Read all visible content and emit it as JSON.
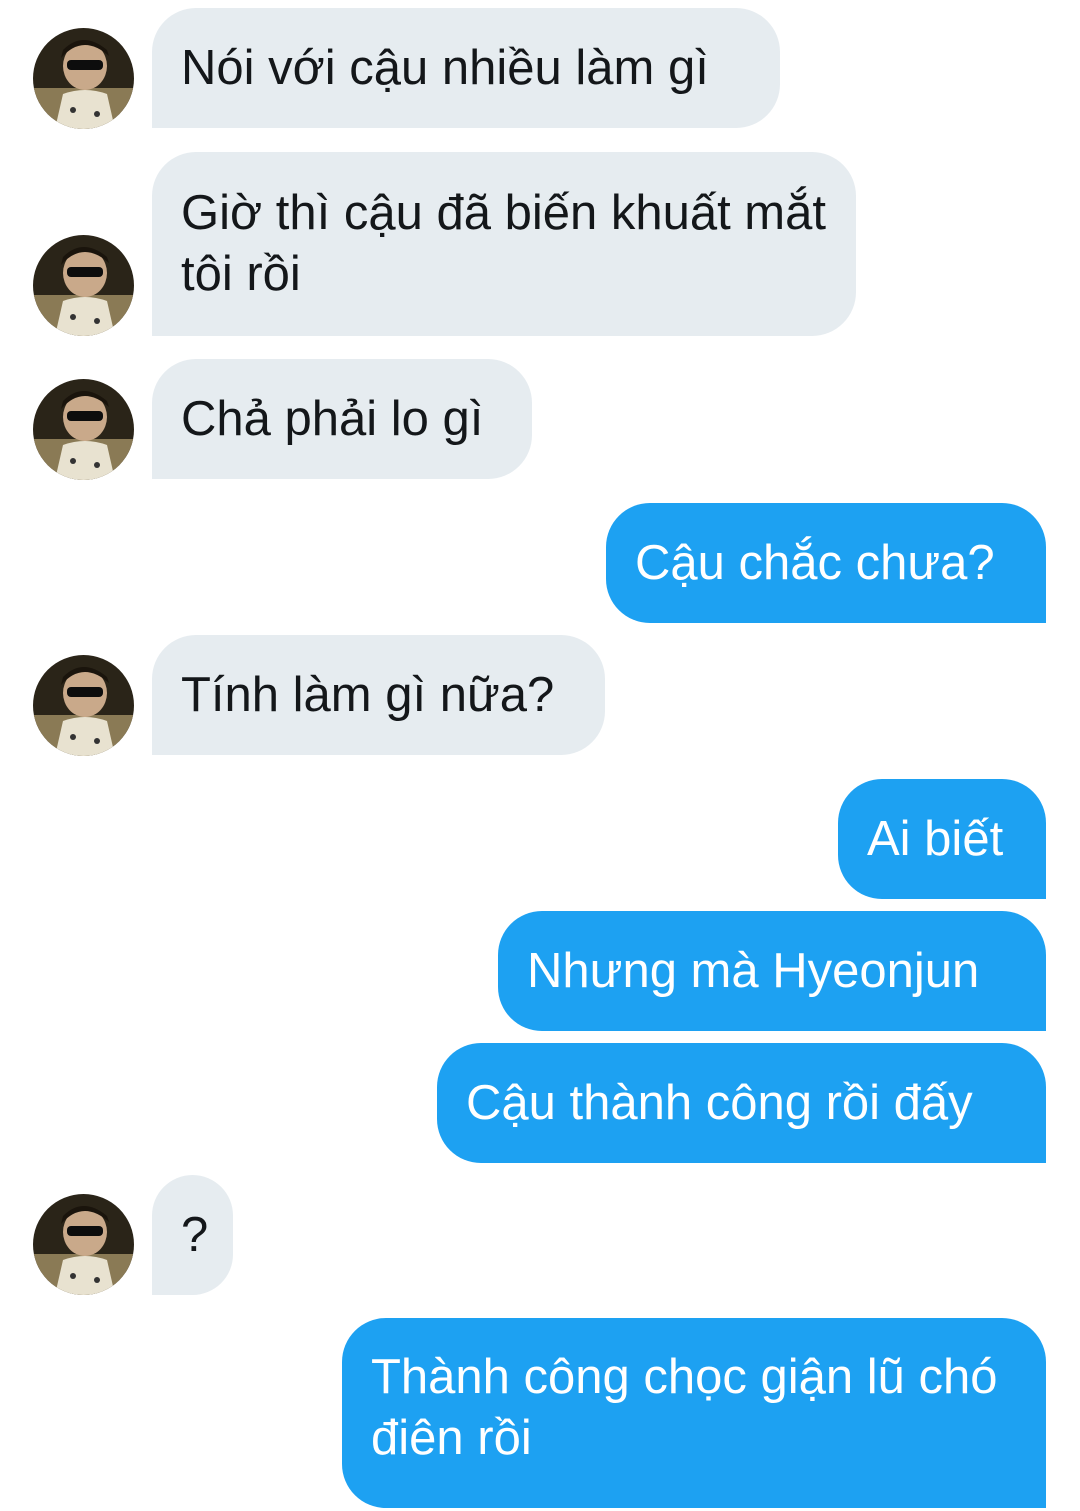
{
  "conversation": {
    "messages": [
      {
        "sender": "them",
        "text": "Nói với cậu nhiều làm gì"
      },
      {
        "sender": "them",
        "text": "Giờ thì cậu đã biến khuất mắt tôi rồi"
      },
      {
        "sender": "them",
        "text": "Chả phải lo gì"
      },
      {
        "sender": "me",
        "text": "Cậu chắc chưa?"
      },
      {
        "sender": "them",
        "text": "Tính làm gì nữa?"
      },
      {
        "sender": "me",
        "text": "Ai biết"
      },
      {
        "sender": "me",
        "text": "Nhưng mà Hyeonjun"
      },
      {
        "sender": "me",
        "text": "Cậu thành công rồi đấy"
      },
      {
        "sender": "them",
        "text": "?"
      },
      {
        "sender": "me",
        "text": "Thành công chọc giận lũ chó điên rồi"
      }
    ]
  },
  "colors": {
    "incoming_bubble": "#e6ecf0",
    "incoming_text": "#14171a",
    "outgoing_bubble": "#1da1f2",
    "outgoing_text": "#ffffff"
  },
  "icons": {
    "avatar": "user-avatar-photo"
  }
}
